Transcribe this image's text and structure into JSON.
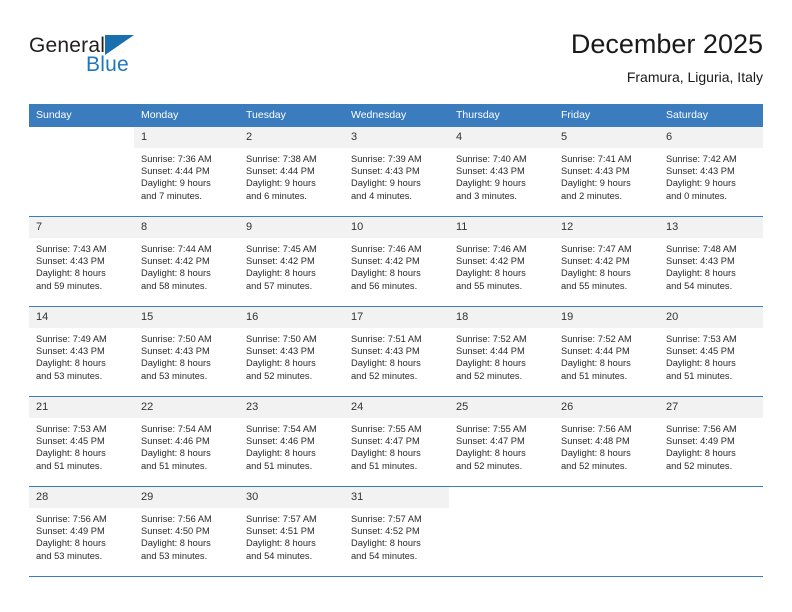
{
  "brand": {
    "name_top": "General",
    "name_bottom": "Blue",
    "triangle_color": "#1a6faf",
    "text_color": "#231f20",
    "blue_color": "#1f77bd"
  },
  "header": {
    "title": "December 2025",
    "subtitle": "Framura, Liguria, Italy"
  },
  "theme": {
    "header_bg": "#3a7cbe",
    "daynum_bg": "#f2f2f2",
    "grid_line": "#3a7cbe"
  },
  "weekday_headers": [
    "Sunday",
    "Monday",
    "Tuesday",
    "Wednesday",
    "Thursday",
    "Friday",
    "Saturday"
  ],
  "weeks": [
    [
      {
        "day": "",
        "lines": []
      },
      {
        "day": "1",
        "lines": [
          "Sunrise: 7:36 AM",
          "Sunset: 4:44 PM",
          "Daylight: 9 hours",
          "and 7 minutes."
        ]
      },
      {
        "day": "2",
        "lines": [
          "Sunrise: 7:38 AM",
          "Sunset: 4:44 PM",
          "Daylight: 9 hours",
          "and 6 minutes."
        ]
      },
      {
        "day": "3",
        "lines": [
          "Sunrise: 7:39 AM",
          "Sunset: 4:43 PM",
          "Daylight: 9 hours",
          "and 4 minutes."
        ]
      },
      {
        "day": "4",
        "lines": [
          "Sunrise: 7:40 AM",
          "Sunset: 4:43 PM",
          "Daylight: 9 hours",
          "and 3 minutes."
        ]
      },
      {
        "day": "5",
        "lines": [
          "Sunrise: 7:41 AM",
          "Sunset: 4:43 PM",
          "Daylight: 9 hours",
          "and 2 minutes."
        ]
      },
      {
        "day": "6",
        "lines": [
          "Sunrise: 7:42 AM",
          "Sunset: 4:43 PM",
          "Daylight: 9 hours",
          "and 0 minutes."
        ]
      }
    ],
    [
      {
        "day": "7",
        "lines": [
          "Sunrise: 7:43 AM",
          "Sunset: 4:43 PM",
          "Daylight: 8 hours",
          "and 59 minutes."
        ]
      },
      {
        "day": "8",
        "lines": [
          "Sunrise: 7:44 AM",
          "Sunset: 4:42 PM",
          "Daylight: 8 hours",
          "and 58 minutes."
        ]
      },
      {
        "day": "9",
        "lines": [
          "Sunrise: 7:45 AM",
          "Sunset: 4:42 PM",
          "Daylight: 8 hours",
          "and 57 minutes."
        ]
      },
      {
        "day": "10",
        "lines": [
          "Sunrise: 7:46 AM",
          "Sunset: 4:42 PM",
          "Daylight: 8 hours",
          "and 56 minutes."
        ]
      },
      {
        "day": "11",
        "lines": [
          "Sunrise: 7:46 AM",
          "Sunset: 4:42 PM",
          "Daylight: 8 hours",
          "and 55 minutes."
        ]
      },
      {
        "day": "12",
        "lines": [
          "Sunrise: 7:47 AM",
          "Sunset: 4:42 PM",
          "Daylight: 8 hours",
          "and 55 minutes."
        ]
      },
      {
        "day": "13",
        "lines": [
          "Sunrise: 7:48 AM",
          "Sunset: 4:43 PM",
          "Daylight: 8 hours",
          "and 54 minutes."
        ]
      }
    ],
    [
      {
        "day": "14",
        "lines": [
          "Sunrise: 7:49 AM",
          "Sunset: 4:43 PM",
          "Daylight: 8 hours",
          "and 53 minutes."
        ]
      },
      {
        "day": "15",
        "lines": [
          "Sunrise: 7:50 AM",
          "Sunset: 4:43 PM",
          "Daylight: 8 hours",
          "and 53 minutes."
        ]
      },
      {
        "day": "16",
        "lines": [
          "Sunrise: 7:50 AM",
          "Sunset: 4:43 PM",
          "Daylight: 8 hours",
          "and 52 minutes."
        ]
      },
      {
        "day": "17",
        "lines": [
          "Sunrise: 7:51 AM",
          "Sunset: 4:43 PM",
          "Daylight: 8 hours",
          "and 52 minutes."
        ]
      },
      {
        "day": "18",
        "lines": [
          "Sunrise: 7:52 AM",
          "Sunset: 4:44 PM",
          "Daylight: 8 hours",
          "and 52 minutes."
        ]
      },
      {
        "day": "19",
        "lines": [
          "Sunrise: 7:52 AM",
          "Sunset: 4:44 PM",
          "Daylight: 8 hours",
          "and 51 minutes."
        ]
      },
      {
        "day": "20",
        "lines": [
          "Sunrise: 7:53 AM",
          "Sunset: 4:45 PM",
          "Daylight: 8 hours",
          "and 51 minutes."
        ]
      }
    ],
    [
      {
        "day": "21",
        "lines": [
          "Sunrise: 7:53 AM",
          "Sunset: 4:45 PM",
          "Daylight: 8 hours",
          "and 51 minutes."
        ]
      },
      {
        "day": "22",
        "lines": [
          "Sunrise: 7:54 AM",
          "Sunset: 4:46 PM",
          "Daylight: 8 hours",
          "and 51 minutes."
        ]
      },
      {
        "day": "23",
        "lines": [
          "Sunrise: 7:54 AM",
          "Sunset: 4:46 PM",
          "Daylight: 8 hours",
          "and 51 minutes."
        ]
      },
      {
        "day": "24",
        "lines": [
          "Sunrise: 7:55 AM",
          "Sunset: 4:47 PM",
          "Daylight: 8 hours",
          "and 51 minutes."
        ]
      },
      {
        "day": "25",
        "lines": [
          "Sunrise: 7:55 AM",
          "Sunset: 4:47 PM",
          "Daylight: 8 hours",
          "and 52 minutes."
        ]
      },
      {
        "day": "26",
        "lines": [
          "Sunrise: 7:56 AM",
          "Sunset: 4:48 PM",
          "Daylight: 8 hours",
          "and 52 minutes."
        ]
      },
      {
        "day": "27",
        "lines": [
          "Sunrise: 7:56 AM",
          "Sunset: 4:49 PM",
          "Daylight: 8 hours",
          "and 52 minutes."
        ]
      }
    ],
    [
      {
        "day": "28",
        "lines": [
          "Sunrise: 7:56 AM",
          "Sunset: 4:49 PM",
          "Daylight: 8 hours",
          "and 53 minutes."
        ]
      },
      {
        "day": "29",
        "lines": [
          "Sunrise: 7:56 AM",
          "Sunset: 4:50 PM",
          "Daylight: 8 hours",
          "and 53 minutes."
        ]
      },
      {
        "day": "30",
        "lines": [
          "Sunrise: 7:57 AM",
          "Sunset: 4:51 PM",
          "Daylight: 8 hours",
          "and 54 minutes."
        ]
      },
      {
        "day": "31",
        "lines": [
          "Sunrise: 7:57 AM",
          "Sunset: 4:52 PM",
          "Daylight: 8 hours",
          "and 54 minutes."
        ]
      },
      {
        "day": "",
        "lines": []
      },
      {
        "day": "",
        "lines": []
      },
      {
        "day": "",
        "lines": []
      }
    ]
  ]
}
